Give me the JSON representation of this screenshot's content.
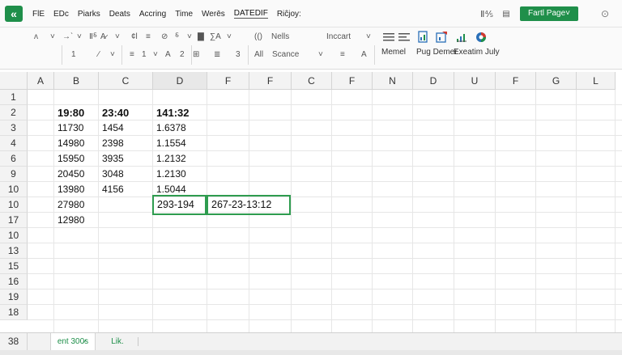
{
  "app": {
    "logo_glyph": "«",
    "accent": "#1f8f4a"
  },
  "menu": {
    "items": [
      "FlE",
      "EDc",
      "Piarks",
      "Deats",
      "Accring",
      "Time",
      "Werēs",
      "DATEDIF",
      "Riĉjoy:"
    ],
    "active_index": 7
  },
  "window": {
    "ribbon_toggle": "Ⅱ⅘",
    "share_label": "Fartl Page˅",
    "close": "⊙"
  },
  "ribbon": {
    "row1": [
      {
        "icon": "line-icon",
        "text": "ʌ"
      },
      {
        "icon": "dropdown-icon",
        "text": "˅"
      },
      {
        "icon": "undo-icon",
        "text": "→ˋ"
      },
      {
        "icon": "dropdown-icon",
        "text": "˅"
      },
      {
        "icon": "paste-icon",
        "text": "Ⅱ⸹"
      },
      {
        "icon": "font-color-icon",
        "text": "A̷"
      },
      {
        "icon": "dropdown-icon",
        "text": "˅"
      },
      {
        "icon": "align-icon",
        "text": "¢l"
      },
      {
        "icon": "copy-icon",
        "text": "≡"
      },
      {
        "icon": "pen-icon",
        "text": "⊘"
      },
      {
        "icon": "format-icon",
        "text": "⸹"
      },
      {
        "icon": "dropdown-icon",
        "text": "˅"
      },
      {
        "icon": "fill-icon",
        "text": "▇"
      },
      {
        "icon": "sum-icon",
        "text": "∑A"
      },
      {
        "icon": "dropdown-icon",
        "text": "˅"
      },
      {
        "icon": "chart-icon",
        "text": "(()"
      },
      {
        "icon": "table-icon",
        "text": "Nells"
      },
      {
        "icon": "insert-icon",
        "text": "Inccart"
      },
      {
        "icon": "dropdown-icon",
        "text": "˅"
      }
    ],
    "row2": [
      {
        "icon": "number-icon",
        "text": "1"
      },
      {
        "icon": "pen-icon",
        "text": "∕"
      },
      {
        "icon": "dropdown-icon",
        "text": "˅"
      },
      {
        "icon": "list-icon",
        "text": "≡"
      },
      {
        "icon": "number-icon",
        "text": "1"
      },
      {
        "icon": "dropdown-icon",
        "text": "˅"
      },
      {
        "icon": "triangle-icon",
        "text": "A"
      },
      {
        "icon": "number-icon",
        "text": "2"
      },
      {
        "icon": "grid-icon",
        "text": "⊞"
      },
      {
        "icon": "list-icon",
        "text": "≣"
      },
      {
        "icon": "number-icon",
        "text": "3"
      },
      {
        "icon": "all-icon",
        "text": "All"
      },
      {
        "icon": "scenario-icon",
        "text": "Scance"
      },
      {
        "icon": "dropdown-icon",
        "text": "˅"
      },
      {
        "icon": "bold-icon",
        "text": "≡"
      },
      {
        "icon": "text-icon",
        "text": "A"
      }
    ],
    "groups": [
      {
        "label": "Memel",
        "icon": "menu-lines-icon"
      },
      {
        "label": "Pug Demer",
        "icon": "doc-icon"
      },
      {
        "label": "Exeatim July",
        "icon": "chart-flag-icon"
      }
    ],
    "extra_icon": "color-wheel-icon"
  },
  "grid": {
    "corner": "",
    "columns": [
      "A",
      "B",
      "C",
      "D",
      "F",
      "F",
      "C",
      "F",
      "N",
      "D",
      "U",
      "F",
      "G",
      "L"
    ],
    "selected_column_index": 3,
    "rows": [
      "1",
      "2",
      "3",
      "4",
      "6",
      "9",
      "10",
      "10",
      "17",
      "10",
      "13",
      "15",
      "16",
      "19",
      "18"
    ],
    "cells": [
      {
        "row": 1,
        "col": 1,
        "text": "19:80",
        "bold": true
      },
      {
        "row": 1,
        "col": 2,
        "text": "23:40",
        "bold": true
      },
      {
        "row": 1,
        "col": 3,
        "text": "141:32",
        "bold": true
      },
      {
        "row": 2,
        "col": 1,
        "text": "11730"
      },
      {
        "row": 2,
        "col": 2,
        "text": "1454"
      },
      {
        "row": 2,
        "col": 3,
        "text": "1.6378"
      },
      {
        "row": 3,
        "col": 1,
        "text": "14980"
      },
      {
        "row": 3,
        "col": 2,
        "text": "2398"
      },
      {
        "row": 3,
        "col": 3,
        "text": "1.1554"
      },
      {
        "row": 4,
        "col": 1,
        "text": "15950"
      },
      {
        "row": 4,
        "col": 2,
        "text": "3935"
      },
      {
        "row": 4,
        "col": 3,
        "text": "1.2132"
      },
      {
        "row": 5,
        "col": 1,
        "text": "20450"
      },
      {
        "row": 5,
        "col": 2,
        "text": "3048"
      },
      {
        "row": 5,
        "col": 3,
        "text": "1.2130"
      },
      {
        "row": 6,
        "col": 1,
        "text": "13980"
      },
      {
        "row": 6,
        "col": 2,
        "text": "4156"
      },
      {
        "row": 6,
        "col": 3,
        "text": "1.5044"
      },
      {
        "row": 7,
        "col": 1,
        "text": "27980"
      },
      {
        "row": 7,
        "col": 3,
        "text": "293-194",
        "boxed": true
      },
      {
        "row": 7,
        "col": 4,
        "text": "267-23-13:12",
        "boxed": true,
        "span": 2
      },
      {
        "row": 8,
        "col": 1,
        "text": "12980"
      }
    ]
  },
  "tabs": {
    "row_indicator": "38",
    "sheets": [
      {
        "label": "ent 300̷s",
        "active": true
      },
      {
        "label": "Lik.",
        "active": false
      }
    ]
  }
}
